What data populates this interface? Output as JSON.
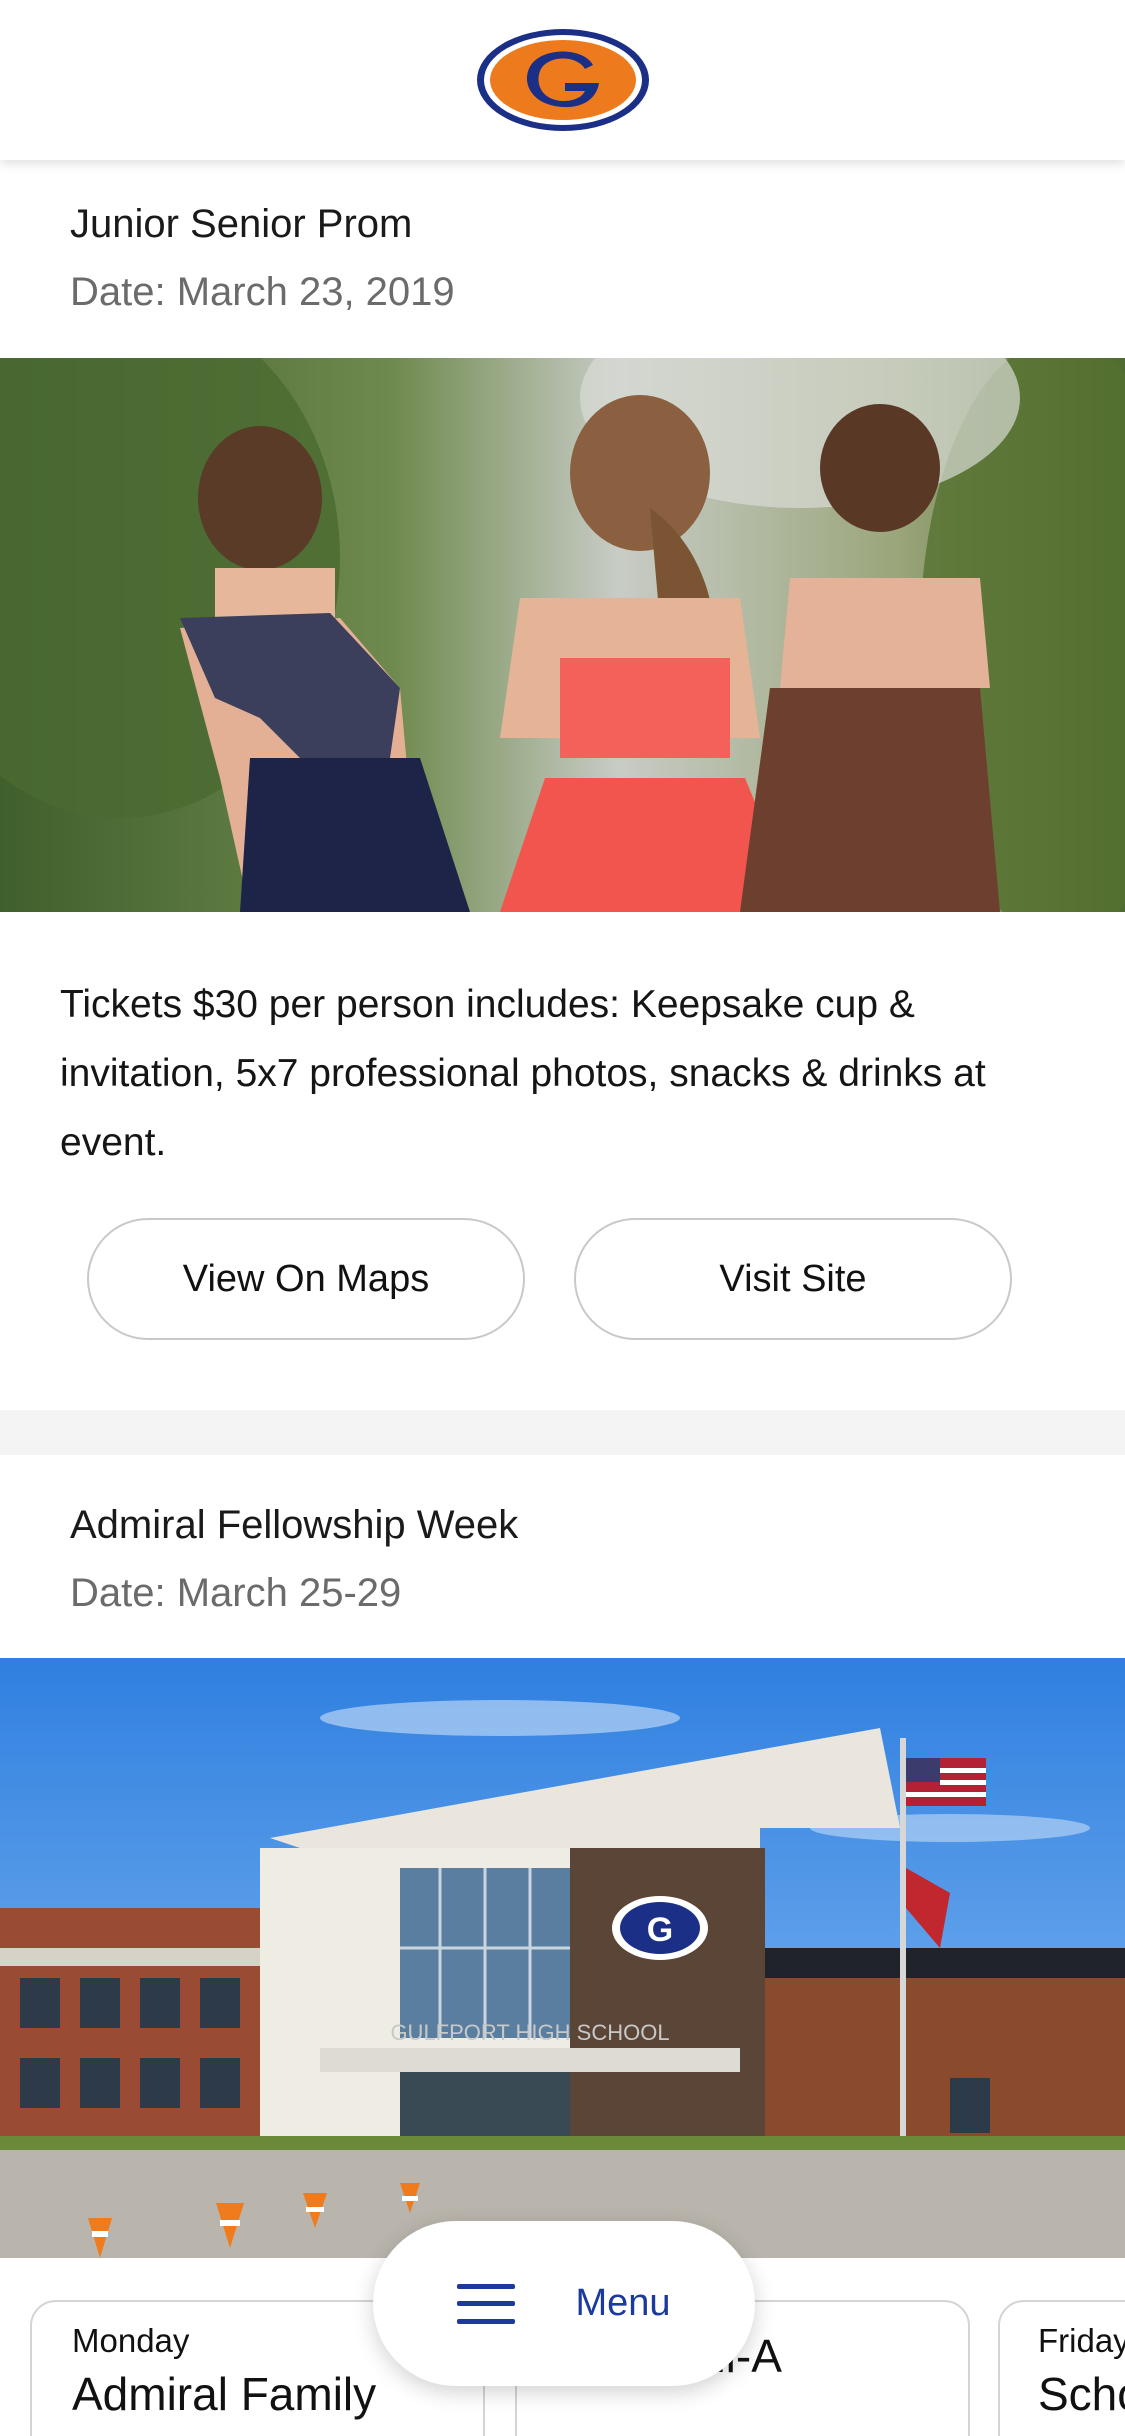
{
  "header": {
    "logo_icon": "gulfport-g-logo-icon",
    "brand_orange": "#ee7a1e",
    "brand_navy": "#1c2f87"
  },
  "events": [
    {
      "title": "Junior Senior Prom",
      "date": "Date: March 23, 2019",
      "image": "prom-photo",
      "description": "Tickets $30 per person includes: Keepsake cup & invitation, 5x7 professional photos, snacks & drinks at event.",
      "buttons": {
        "maps": "View On Maps",
        "site": "Visit Site"
      }
    },
    {
      "title": "Admiral Fellowship Week",
      "date": "Date: March 25-29",
      "image": "school-building-photo",
      "image_sign": "GULFPORT HIGH SCHOOL",
      "days": [
        {
          "day": "Monday",
          "event": "Admiral Family"
        },
        {
          "day": "",
          "event": "Chick-Fil-A"
        },
        {
          "day": "Friday",
          "event": "Scho"
        }
      ]
    }
  ],
  "menu": {
    "label": "Menu",
    "icon": "hamburger-menu-icon"
  }
}
